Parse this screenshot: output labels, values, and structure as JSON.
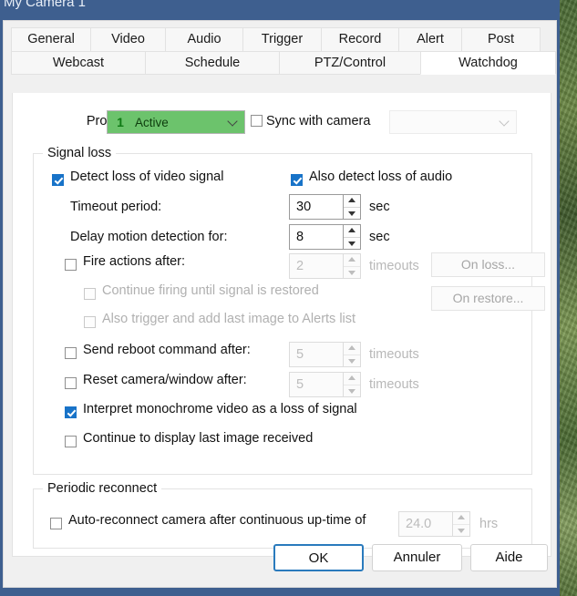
{
  "window": {
    "title": "My Camera 1"
  },
  "tabs": {
    "row1": [
      {
        "label": "General",
        "selected": false
      },
      {
        "label": "Video",
        "selected": false
      },
      {
        "label": "Audio",
        "selected": false
      },
      {
        "label": "Trigger",
        "selected": false
      },
      {
        "label": "Record",
        "selected": false
      },
      {
        "label": "Alert",
        "selected": false
      },
      {
        "label": "Post",
        "selected": false
      }
    ],
    "row2": [
      {
        "label": "Webcast",
        "selected": false
      },
      {
        "label": "Schedule",
        "selected": false
      },
      {
        "label": "PTZ/Control",
        "selected": false
      },
      {
        "label": "Watchdog",
        "selected": true
      }
    ]
  },
  "profile": {
    "label": "Profile:",
    "number": "1",
    "value": "Active",
    "color": "#6cc36c",
    "sync_label": "Sync with camera",
    "sync_checked": false,
    "sync_combo_value": ""
  },
  "signal_loss": {
    "title": "Signal loss",
    "detect_video": {
      "label": "Detect loss of video signal",
      "checked": true
    },
    "detect_audio": {
      "label": "Also detect loss of audio",
      "checked": true
    },
    "timeout_period": {
      "label": "Timeout period:",
      "value": "30",
      "unit": "sec",
      "disabled": false
    },
    "delay_motion": {
      "label": "Delay motion detection for:",
      "value": "8",
      "unit": "sec",
      "disabled": false
    },
    "fire_actions": {
      "label": "Fire actions after:",
      "checked": false,
      "value": "2",
      "unit": "timeouts",
      "disabled": true
    },
    "continue_firing": {
      "label": "Continue firing until signal is restored",
      "checked": false,
      "disabled": true
    },
    "also_trigger": {
      "label": "Also trigger and add last image to Alerts list",
      "checked": false,
      "disabled": true
    },
    "on_loss_button": {
      "label": "On loss...",
      "disabled": true
    },
    "on_restore_button": {
      "label": "On restore...",
      "disabled": true
    },
    "send_reboot": {
      "label": "Send reboot command after:",
      "checked": false,
      "value": "5",
      "unit": "timeouts",
      "disabled": true
    },
    "reset_camera": {
      "label": "Reset camera/window after:",
      "checked": false,
      "value": "5",
      "unit": "timeouts",
      "disabled": true
    },
    "interpret_mono": {
      "label": "Interpret monochrome video as a loss of signal",
      "checked": true
    },
    "continue_display": {
      "label": "Continue to display last image received",
      "checked": false
    }
  },
  "periodic_reconnect": {
    "title": "Periodic reconnect",
    "auto_reconnect": {
      "label": "Auto-reconnect camera after continuous up-time of",
      "checked": false,
      "value": "24.0",
      "unit": "hrs",
      "disabled": true
    }
  },
  "footer": {
    "ok": "OK",
    "cancel": "Annuler",
    "help": "Aide"
  }
}
